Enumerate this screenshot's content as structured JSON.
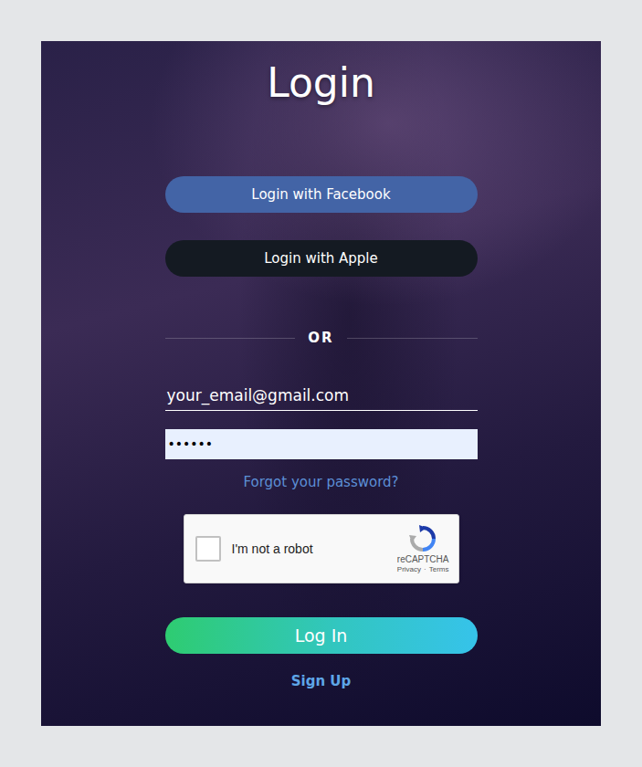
{
  "page": {
    "title": "Login"
  },
  "social_buttons": [
    {
      "label": "Login with Facebook",
      "color": "#4364a6"
    },
    {
      "label": "Login with Apple",
      "color": "#141a22"
    }
  ],
  "divider": "OR",
  "email_field": {
    "value": "your_email@gmail.com"
  },
  "password_field": {
    "value": "••••••",
    "autofilled": true
  },
  "forgot_link": "Forgot your password?",
  "captcha": {
    "label": "I'm not a robot",
    "checked": false,
    "brand": "reCAPTCHA",
    "links": [
      "Privacy",
      "Terms"
    ],
    "separator": "·"
  },
  "login_button": "Log In",
  "signup_link": "Sign Up"
}
